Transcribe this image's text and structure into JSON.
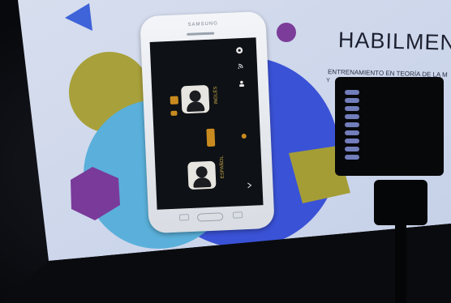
{
  "screen": {
    "headline": "HABILMEN",
    "subline": "ENTRENAMIENTO EN TEORÍA DE LA M",
    "subline2": "Y"
  },
  "phone": {
    "brand": "SAMSUNG",
    "app_labels": [
      "INGLÉS",
      "ESPAÑOL"
    ]
  },
  "colors": {
    "projection_bg": "#dfe6f4",
    "blue_circle": "#3a52d6",
    "light_blue_circle": "#5ab0da",
    "olive_circle": "#a8a03a",
    "purple_hex": "#7a3a9a",
    "olive_square": "#a49d36",
    "purple_dot": "#7b3d99",
    "blue_triangle": "#3f63d9"
  },
  "icons": [
    "cast-icon",
    "settings-icon",
    "person-icon",
    "chevron-right-icon"
  ]
}
